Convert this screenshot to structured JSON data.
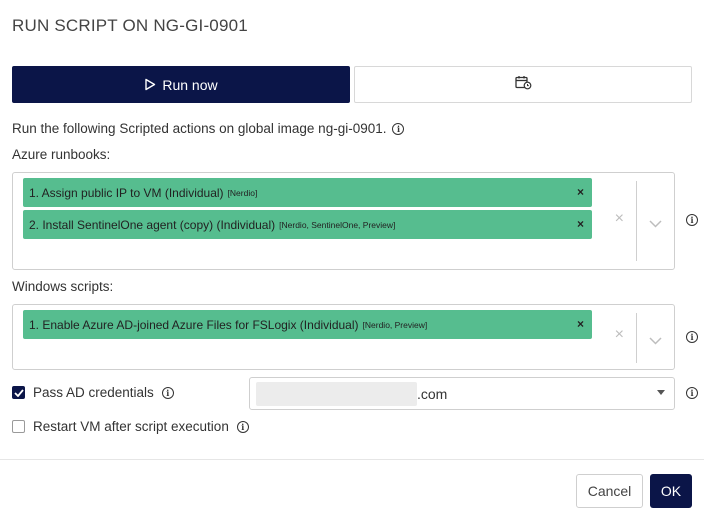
{
  "dialog": {
    "title": "RUN SCRIPT ON NG-GI-0901"
  },
  "mode_tabs": {
    "run_now_label": "Run now",
    "run_now_icon": "play-icon",
    "schedule_icon": "calendar-clock-icon"
  },
  "description": "Run the following Scripted actions on global image ng-gi-0901.",
  "azure_runbooks": {
    "label": "Azure runbooks:",
    "items": [
      {
        "name": "1. Assign public IP to VM (Individual)",
        "tags": "[Nerdio]"
      },
      {
        "name": "2. Install SentinelOne agent (copy) (Individual)",
        "tags": "[Nerdio, SentinelOne, Preview]"
      }
    ]
  },
  "windows_scripts": {
    "label": "Windows scripts:",
    "items": [
      {
        "name": "1. Enable Azure AD-joined Azure Files for FSLogix (Individual)",
        "tags": "[Nerdio, Preview]"
      }
    ]
  },
  "pass_ad_credentials": {
    "label": "Pass AD credentials",
    "checked": true,
    "selected_value": ".com"
  },
  "restart_vm": {
    "label": "Restart VM after script execution",
    "checked": false
  },
  "footer": {
    "cancel_label": "Cancel",
    "ok_label": "OK"
  },
  "colors": {
    "primary": "#0b1548",
    "chip": "#56bd8f"
  }
}
